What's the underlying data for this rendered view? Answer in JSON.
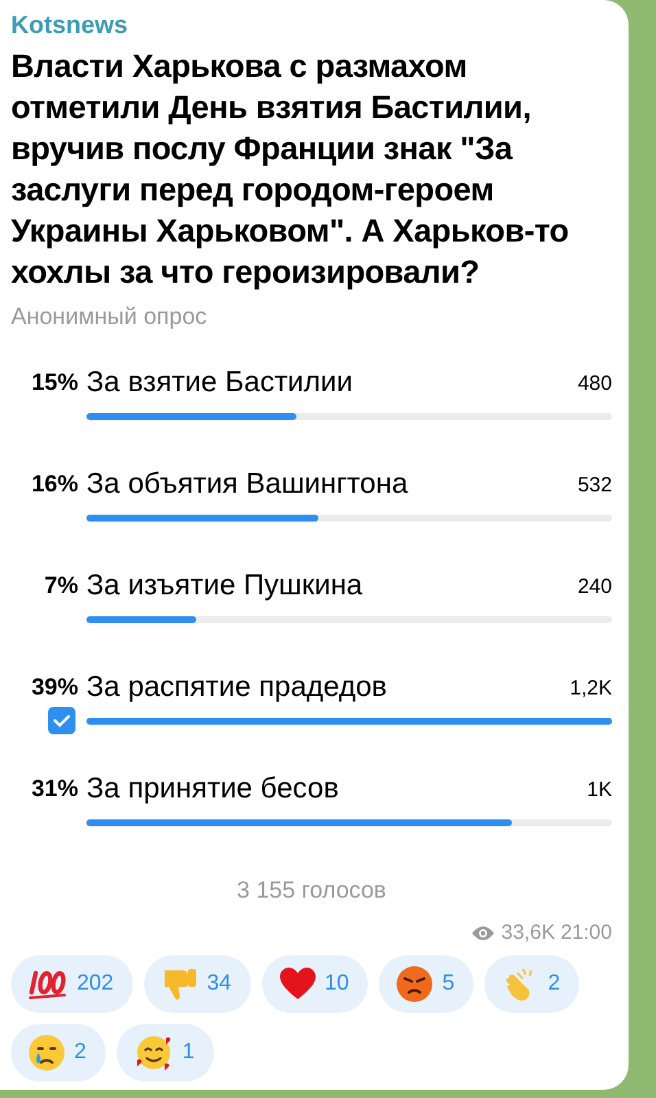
{
  "channel": "Kotsnews",
  "question": "Власти Харькова с размахом отметили День взятия Бастилии, вручив послу Франции  знак \"За заслуги перед городом-героем Украины Харьковом\". А Харьков-то хохлы за что  героизировали?",
  "poll_type": "Анонимный опрос",
  "options": [
    {
      "percent": "15%",
      "text": "За взятие Бастилии",
      "votes": "480",
      "level": 0.4,
      "checked": false
    },
    {
      "percent": "16%",
      "text": "За объятия Вашингтона",
      "votes": "532",
      "level": 0.44,
      "checked": false
    },
    {
      "percent": "7%",
      "text": "За изъятие Пушкина",
      "votes": "240",
      "level": 0.21,
      "checked": false
    },
    {
      "percent": "39%",
      "text": "За распятие прадедов",
      "votes": "1,2K",
      "level": 1,
      "checked": true
    },
    {
      "percent": "31%",
      "text": "За принятие бесов",
      "votes": "1K",
      "level": 0.81,
      "checked": false
    }
  ],
  "total_votes": "3 155 голосов",
  "views": "33,6K",
  "time": "21:00",
  "reactions": [
    {
      "kind": "hundred",
      "count": "202"
    },
    {
      "kind": "thumbsdown",
      "count": "34"
    },
    {
      "kind": "heart",
      "count": "10"
    },
    {
      "kind": "angry",
      "count": "5"
    },
    {
      "kind": "clap",
      "count": "2"
    },
    {
      "kind": "cry",
      "count": "2"
    },
    {
      "kind": "hearts",
      "count": "1"
    }
  ]
}
